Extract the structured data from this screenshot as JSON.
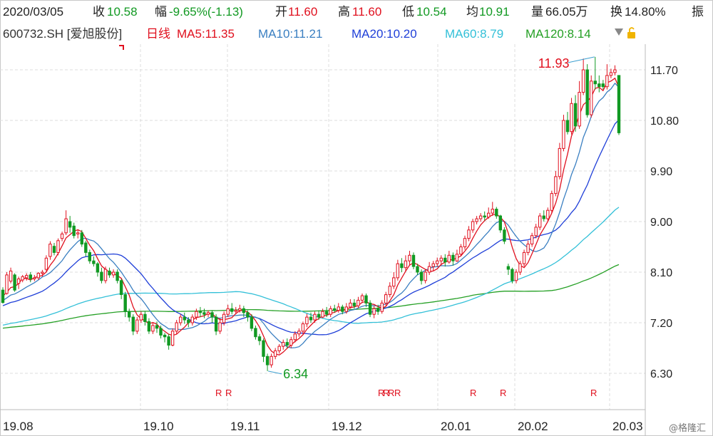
{
  "info_bar": {
    "date": "2020/03/05",
    "close_label": "收",
    "close": "10.58",
    "change_label": "幅",
    "change": "-9.65%(-1.13)",
    "open_label": "开",
    "open": "11.60",
    "high_label": "高",
    "high": "11.60",
    "low_label": "低",
    "low": "10.54",
    "avg_label": "均",
    "avg": "10.91",
    "volume_label": "量",
    "volume": "66.05万",
    "turnover_label": "换",
    "turnover": "14.80%",
    "amplitude_label": "振"
  },
  "ma_bar": {
    "symbol": "600732.SH [爱旭股份]",
    "period": "日线",
    "ma5": "MA5:11.35",
    "ma10": "MA10:11.21",
    "ma20": "MA20:10.20",
    "ma60": "MA60:8.79",
    "ma120": "MA120:8.14",
    "menu_icon": "triangle-down-icon",
    "lock_icon": "lock-icon"
  },
  "colors": {
    "up": "#e0101e",
    "down": "#119922",
    "ma5": "#e0101e",
    "ma10": "#3a7fc1",
    "ma20": "#1f3fd8",
    "ma60": "#33c0d8",
    "ma120": "#25a025",
    "grid": "#dcdcdc"
  },
  "watermark": "@格隆汇",
  "chart_data": {
    "type": "candlestick",
    "y_ticks": [
      "11.70",
      "10.80",
      "9.90",
      "9.00",
      "8.10",
      "7.20",
      "6.30"
    ],
    "x_ticks": [
      "19.08",
      "19.10",
      "19.11",
      "19.12",
      "20.01",
      "20.02",
      "20.03"
    ],
    "ylim": [
      5.9,
      12.4
    ],
    "annotations": [
      {
        "label": "11.93",
        "note": "period high"
      },
      {
        "label": "6.34",
        "note": "period low"
      }
    ],
    "markers": {
      "label": "R",
      "count": 9
    },
    "candles": [
      [
        7.78,
        7.56,
        7.83,
        7.54
      ],
      [
        7.72,
        8.05,
        8.1,
        7.7
      ],
      [
        7.94,
        8.12,
        8.18,
        7.9
      ],
      [
        8.05,
        7.78,
        8.08,
        7.75
      ],
      [
        7.9,
        7.98,
        8.02,
        7.8
      ],
      [
        7.96,
        8.02,
        8.05,
        7.92
      ],
      [
        8.0,
        8.04,
        8.08,
        7.95
      ],
      [
        8.05,
        7.98,
        8.1,
        7.92
      ],
      [
        7.98,
        8.0,
        8.05,
        7.94
      ],
      [
        8.0,
        8.08,
        8.1,
        7.96
      ],
      [
        8.08,
        8.1,
        8.14,
        8.02
      ],
      [
        8.15,
        8.35,
        8.4,
        8.1
      ],
      [
        8.38,
        8.6,
        8.65,
        8.32
      ],
      [
        8.56,
        8.45,
        8.62,
        8.4
      ],
      [
        8.45,
        8.66,
        8.7,
        8.4
      ],
      [
        8.7,
        8.78,
        8.82,
        8.65
      ],
      [
        8.8,
        9.05,
        9.2,
        8.76
      ],
      [
        9.0,
        8.9,
        9.1,
        8.8
      ],
      [
        8.92,
        8.75,
        8.98,
        8.7
      ],
      [
        8.78,
        8.8,
        8.86,
        8.7
      ],
      [
        8.8,
        8.6,
        8.85,
        8.55
      ],
      [
        8.62,
        8.45,
        8.66,
        8.38
      ],
      [
        8.45,
        8.3,
        8.5,
        8.25
      ],
      [
        8.3,
        8.25,
        8.38,
        8.2
      ],
      [
        8.25,
        8.1,
        8.28,
        8.02
      ],
      [
        8.1,
        7.95,
        8.18,
        7.9
      ],
      [
        7.95,
        8.15,
        8.2,
        7.9
      ],
      [
        8.12,
        8.05,
        8.18,
        8.0
      ],
      [
        8.05,
        8.1,
        8.15,
        8.0
      ],
      [
        8.1,
        7.95,
        8.15,
        7.9
      ],
      [
        7.95,
        7.7,
        7.98,
        7.62
      ],
      [
        7.7,
        7.4,
        7.75,
        7.3
      ],
      [
        7.4,
        7.3,
        7.45,
        7.22
      ],
      [
        7.3,
        7.05,
        7.35,
        6.98
      ],
      [
        7.05,
        7.25,
        7.3,
        7.0
      ],
      [
        7.25,
        7.35,
        7.4,
        7.2
      ],
      [
        7.35,
        7.22,
        7.4,
        7.15
      ],
      [
        7.22,
        7.05,
        7.28,
        7.0
      ],
      [
        7.05,
        7.15,
        7.2,
        7.0
      ],
      [
        7.15,
        7.1,
        7.22,
        7.02
      ],
      [
        7.1,
        6.98,
        7.15,
        6.92
      ],
      [
        6.98,
        6.95,
        7.02,
        6.85
      ],
      [
        6.95,
        6.8,
        7.0,
        6.72
      ],
      [
        6.8,
        7.05,
        7.1,
        6.78
      ],
      [
        7.05,
        7.2,
        7.25,
        7.0
      ],
      [
        7.2,
        7.3,
        7.35,
        7.15
      ],
      [
        7.3,
        7.25,
        7.38,
        7.18
      ],
      [
        7.25,
        7.2,
        7.3,
        7.12
      ],
      [
        7.2,
        7.3,
        7.35,
        7.15
      ],
      [
        7.3,
        7.4,
        7.45,
        7.25
      ],
      [
        7.4,
        7.38,
        7.48,
        7.3
      ],
      [
        7.38,
        7.35,
        7.45,
        7.28
      ],
      [
        7.35,
        7.38,
        7.42,
        7.3
      ],
      [
        7.38,
        7.3,
        7.42,
        7.2
      ],
      [
        7.3,
        7.05,
        7.35,
        6.98
      ],
      [
        7.05,
        7.2,
        7.28,
        7.0
      ],
      [
        7.2,
        7.35,
        7.4,
        7.15
      ],
      [
        7.35,
        7.45,
        7.52,
        7.3
      ],
      [
        7.45,
        7.4,
        7.55,
        7.35
      ],
      [
        7.4,
        7.42,
        7.48,
        7.35
      ],
      [
        7.42,
        7.45,
        7.52,
        7.38
      ],
      [
        7.45,
        7.38,
        7.5,
        7.3
      ],
      [
        7.38,
        7.3,
        7.42,
        7.22
      ],
      [
        7.3,
        7.1,
        7.35,
        7.05
      ],
      [
        7.1,
        6.95,
        7.15,
        6.9
      ],
      [
        6.95,
        6.88,
        7.0,
        6.8
      ],
      [
        6.88,
        6.6,
        6.92,
        6.5
      ],
      [
        6.6,
        6.45,
        6.65,
        6.34
      ],
      [
        6.45,
        6.6,
        6.65,
        6.4
      ],
      [
        6.6,
        6.7,
        6.75,
        6.55
      ],
      [
        6.7,
        6.78,
        6.82,
        6.65
      ],
      [
        6.78,
        6.85,
        6.9,
        6.72
      ],
      [
        6.85,
        6.8,
        6.92,
        6.75
      ],
      [
        6.8,
        6.9,
        6.95,
        6.75
      ],
      [
        6.9,
        7.0,
        7.05,
        6.85
      ],
      [
        7.0,
        7.05,
        7.1,
        6.95
      ],
      [
        7.05,
        7.18,
        7.22,
        7.0
      ],
      [
        7.18,
        7.3,
        7.36,
        7.12
      ],
      [
        7.3,
        7.25,
        7.38,
        7.2
      ],
      [
        7.25,
        7.35,
        7.4,
        7.2
      ],
      [
        7.35,
        7.3,
        7.42,
        7.25
      ],
      [
        7.3,
        7.4,
        7.45,
        7.28
      ],
      [
        7.4,
        7.35,
        7.48,
        7.3
      ],
      [
        7.35,
        7.45,
        7.5,
        7.3
      ],
      [
        7.45,
        7.42,
        7.52,
        7.38
      ],
      [
        7.42,
        7.48,
        7.55,
        7.38
      ],
      [
        7.48,
        7.4,
        7.52,
        7.35
      ],
      [
        7.4,
        7.48,
        7.55,
        7.36
      ],
      [
        7.48,
        7.55,
        7.62,
        7.45
      ],
      [
        7.55,
        7.5,
        7.62,
        7.45
      ],
      [
        7.5,
        7.6,
        7.66,
        7.46
      ],
      [
        7.6,
        7.68,
        7.72,
        7.55
      ],
      [
        7.68,
        7.55,
        7.72,
        7.48
      ],
      [
        7.55,
        7.35,
        7.6,
        7.3
      ],
      [
        7.35,
        7.45,
        7.5,
        7.28
      ],
      [
        7.45,
        7.4,
        7.52,
        7.34
      ],
      [
        7.4,
        7.55,
        7.6,
        7.36
      ],
      [
        7.55,
        7.7,
        7.75,
        7.5
      ],
      [
        7.7,
        7.85,
        7.92,
        7.65
      ],
      [
        7.85,
        8.0,
        8.1,
        7.8
      ],
      [
        8.0,
        8.25,
        8.32,
        7.95
      ],
      [
        8.25,
        8.18,
        8.35,
        8.1
      ],
      [
        8.18,
        8.3,
        8.4,
        8.12
      ],
      [
        8.3,
        8.4,
        8.48,
        8.22
      ],
      [
        8.4,
        8.2,
        8.45,
        8.15
      ],
      [
        8.2,
        8.1,
        8.25,
        8.05
      ],
      [
        8.1,
        7.95,
        8.15,
        7.88
      ],
      [
        7.95,
        8.1,
        8.15,
        7.9
      ],
      [
        8.1,
        8.2,
        8.28,
        8.05
      ],
      [
        8.2,
        8.25,
        8.3,
        8.12
      ],
      [
        8.25,
        8.3,
        8.36,
        8.2
      ],
      [
        8.3,
        8.35,
        8.4,
        8.22
      ],
      [
        8.35,
        8.28,
        8.42,
        8.2
      ],
      [
        8.28,
        8.4,
        8.48,
        8.25
      ],
      [
        8.4,
        8.3,
        8.45,
        8.22
      ],
      [
        8.3,
        8.42,
        8.5,
        8.28
      ],
      [
        8.42,
        8.55,
        8.6,
        8.38
      ],
      [
        8.55,
        8.7,
        8.75,
        8.5
      ],
      [
        8.7,
        8.85,
        8.92,
        8.65
      ],
      [
        8.85,
        9.0,
        9.05,
        8.8
      ],
      [
        9.0,
        9.05,
        9.1,
        8.95
      ],
      [
        9.05,
        9.1,
        9.15,
        9.0
      ],
      [
        9.1,
        9.08,
        9.18,
        9.02
      ],
      [
        9.08,
        9.15,
        9.25,
        9.05
      ],
      [
        9.15,
        9.22,
        9.35,
        9.1
      ],
      [
        9.22,
        9.1,
        9.26,
        9.05
      ],
      [
        9.1,
        8.85,
        9.12,
        8.8
      ],
      [
        8.85,
        8.65,
        8.9,
        8.6
      ],
      [
        8.2,
        8.15,
        8.25,
        8.05
      ],
      [
        8.15,
        7.95,
        8.18,
        7.9
      ],
      [
        7.95,
        8.1,
        8.15,
        7.9
      ],
      [
        8.1,
        8.25,
        8.3,
        8.05
      ],
      [
        8.25,
        8.45,
        8.5,
        8.2
      ],
      [
        8.45,
        8.6,
        8.66,
        8.4
      ],
      [
        8.6,
        8.75,
        8.8,
        8.55
      ],
      [
        8.75,
        8.9,
        8.96,
        8.7
      ],
      [
        8.9,
        9.1,
        9.15,
        8.85
      ],
      [
        9.1,
        9.05,
        9.2,
        9.0
      ],
      [
        9.05,
        9.2,
        9.25,
        9.0
      ],
      [
        9.2,
        9.5,
        9.55,
        9.15
      ],
      [
        9.5,
        9.8,
        9.9,
        9.45
      ],
      [
        9.8,
        10.3,
        10.4,
        9.75
      ],
      [
        10.3,
        10.8,
        10.9,
        10.25
      ],
      [
        10.8,
        10.6,
        10.95,
        10.55
      ],
      [
        10.6,
        11.1,
        11.2,
        10.55
      ],
      [
        11.1,
        10.7,
        11.25,
        10.6
      ],
      [
        10.7,
        11.3,
        11.5,
        10.65
      ],
      [
        11.3,
        11.7,
        11.9,
        11.25
      ],
      [
        11.7,
        10.9,
        11.8,
        10.85
      ],
      [
        10.9,
        11.5,
        11.6,
        10.85
      ],
      [
        11.5,
        11.45,
        11.93,
        11.35
      ],
      [
        11.45,
        11.4,
        11.6,
        11.3
      ],
      [
        11.45,
        11.4,
        11.52,
        11.35
      ],
      [
        11.4,
        11.6,
        11.8,
        11.35
      ],
      [
        11.6,
        11.65,
        11.72,
        11.55
      ],
      [
        11.65,
        11.7,
        11.78,
        11.6
      ],
      [
        11.6,
        10.58,
        11.6,
        10.54
      ]
    ]
  }
}
